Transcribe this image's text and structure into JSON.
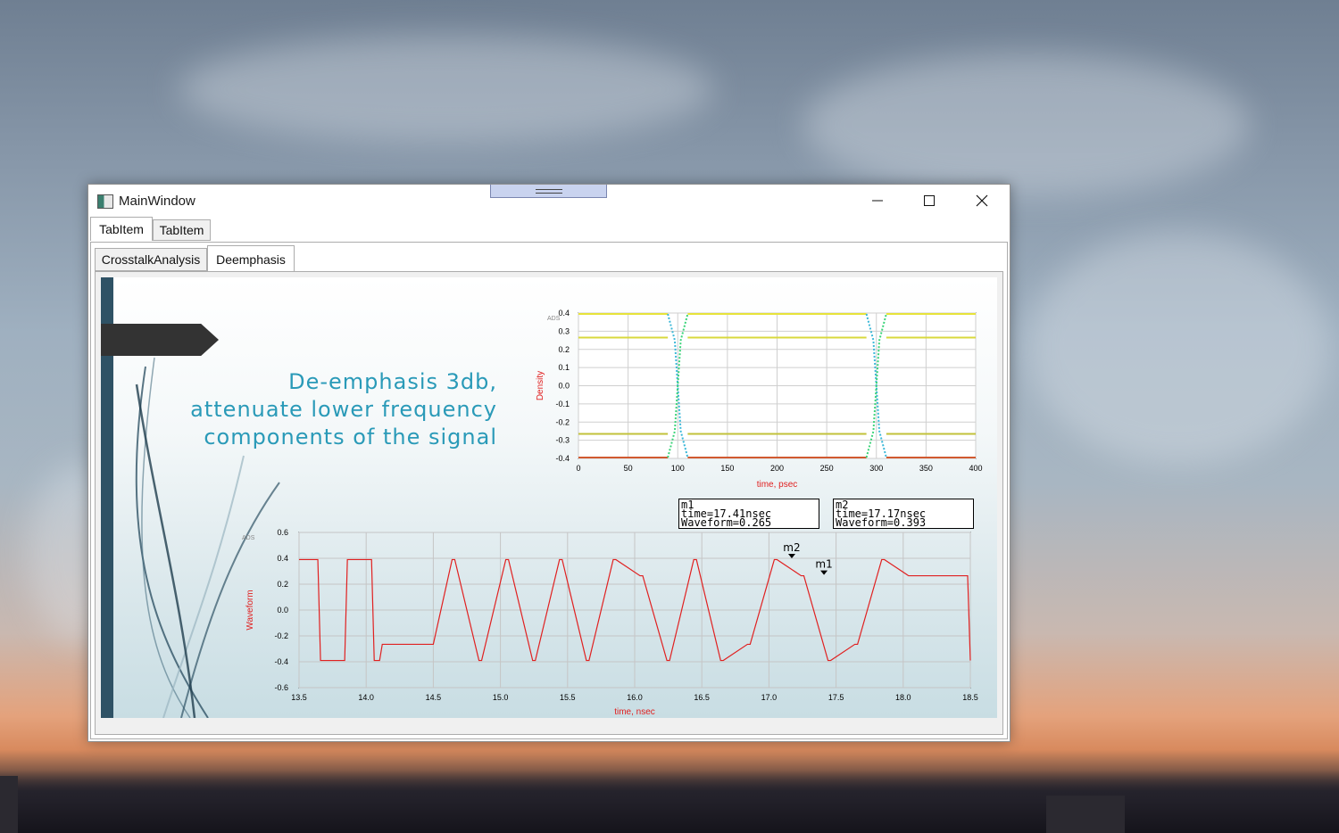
{
  "window": {
    "title": "MainWindow"
  },
  "outer_tabs": [
    {
      "label": "TabItem",
      "selected": true
    },
    {
      "label": "TabItem",
      "selected": false
    }
  ],
  "inner_tabs": [
    {
      "label": "CrosstalkAnalysis",
      "selected": false
    },
    {
      "label": "Deemphasis",
      "selected": true
    }
  ],
  "slide": {
    "headline_lines": [
      "De-emphasis 3db,",
      "attenuate lower frequency",
      "components of the signal"
    ]
  },
  "markers": [
    {
      "name": "m1",
      "time": "time=17.41nsec",
      "waveform": "Waveform=0.265"
    },
    {
      "name": "m2",
      "time": "time=17.17nsec",
      "waveform": "Waveform=0.393"
    }
  ],
  "colors": {
    "accent_text": "#2a9ab8",
    "slide_bar": "#2f5265",
    "trace": "#e02020",
    "axis_label": "#e02020"
  },
  "chart_data": [
    {
      "type": "scatter",
      "name": "eye-diagram",
      "brand": "ADS",
      "xlabel": "time, psec",
      "ylabel": "Density",
      "xlim": [
        0,
        400
      ],
      "ylim": [
        -0.4,
        0.4
      ],
      "xticks": [
        0,
        50,
        100,
        150,
        200,
        250,
        300,
        350,
        400
      ],
      "yticks": [
        0.4,
        0.3,
        0.2,
        0.1,
        0.0,
        -0.1,
        -0.2,
        -0.3,
        -0.4
      ],
      "ytick_labels": [
        "0.4",
        "0.3",
        "0.2",
        "0.1",
        "0.0",
        "-0.1",
        "-0.2",
        "-0.3",
        "-0.4"
      ],
      "levels": [
        0.395,
        0.265,
        -0.265,
        -0.395
      ],
      "crossings": [
        100,
        300
      ],
      "grid": true
    },
    {
      "type": "line",
      "name": "waveform",
      "brand": "ADS",
      "xlabel": "time, nsec",
      "ylabel": "Waveform",
      "xlim": [
        13.5,
        18.5
      ],
      "ylim": [
        -0.6,
        0.6
      ],
      "xticks": [
        13.5,
        14.0,
        14.5,
        15.0,
        15.5,
        16.0,
        16.5,
        17.0,
        17.5,
        18.0,
        18.5
      ],
      "xtick_labels": [
        "13.5",
        "14.0",
        "14.5",
        "15.0",
        "15.5",
        "16.0",
        "16.5",
        "17.0",
        "17.5",
        "18.0",
        "18.5"
      ],
      "yticks": [
        0.6,
        0.4,
        0.2,
        0.0,
        -0.2,
        -0.4,
        -0.6
      ],
      "ytick_labels": [
        "0.6",
        "0.4",
        "0.2",
        "0.0",
        "-0.2",
        "-0.4",
        "-0.6"
      ],
      "x": [
        13.5,
        13.64,
        13.66,
        13.84,
        13.86,
        14.04,
        14.06,
        14.1,
        14.12,
        14.5,
        14.64,
        14.66,
        14.84,
        14.86,
        15.04,
        15.06,
        15.24,
        15.26,
        15.44,
        15.46,
        15.64,
        15.66,
        15.84,
        15.86,
        16.04,
        16.06,
        16.24,
        16.26,
        16.44,
        16.46,
        16.64,
        16.66,
        16.84,
        16.86,
        17.04,
        17.06,
        17.24,
        17.26,
        17.44,
        17.46,
        17.64,
        17.66,
        17.84,
        17.86,
        18.04,
        18.06,
        18.48,
        18.5
      ],
      "y": [
        0.39,
        0.39,
        -0.39,
        -0.39,
        0.39,
        0.39,
        -0.39,
        -0.39,
        -0.265,
        -0.265,
        0.39,
        0.39,
        -0.39,
        -0.39,
        0.39,
        0.39,
        -0.39,
        -0.39,
        0.39,
        0.39,
        -0.39,
        -0.39,
        0.39,
        0.39,
        0.265,
        0.265,
        -0.39,
        -0.39,
        0.39,
        0.39,
        -0.39,
        -0.39,
        -0.265,
        -0.265,
        0.39,
        0.39,
        0.265,
        0.265,
        -0.39,
        -0.39,
        -0.265,
        -0.265,
        0.39,
        0.39,
        0.265,
        0.265,
        0.265,
        -0.39
      ],
      "markers": [
        {
          "label": "m1",
          "x": 17.41,
          "y": 0.265
        },
        {
          "label": "m2",
          "x": 17.17,
          "y": 0.393
        }
      ],
      "grid": true
    }
  ]
}
